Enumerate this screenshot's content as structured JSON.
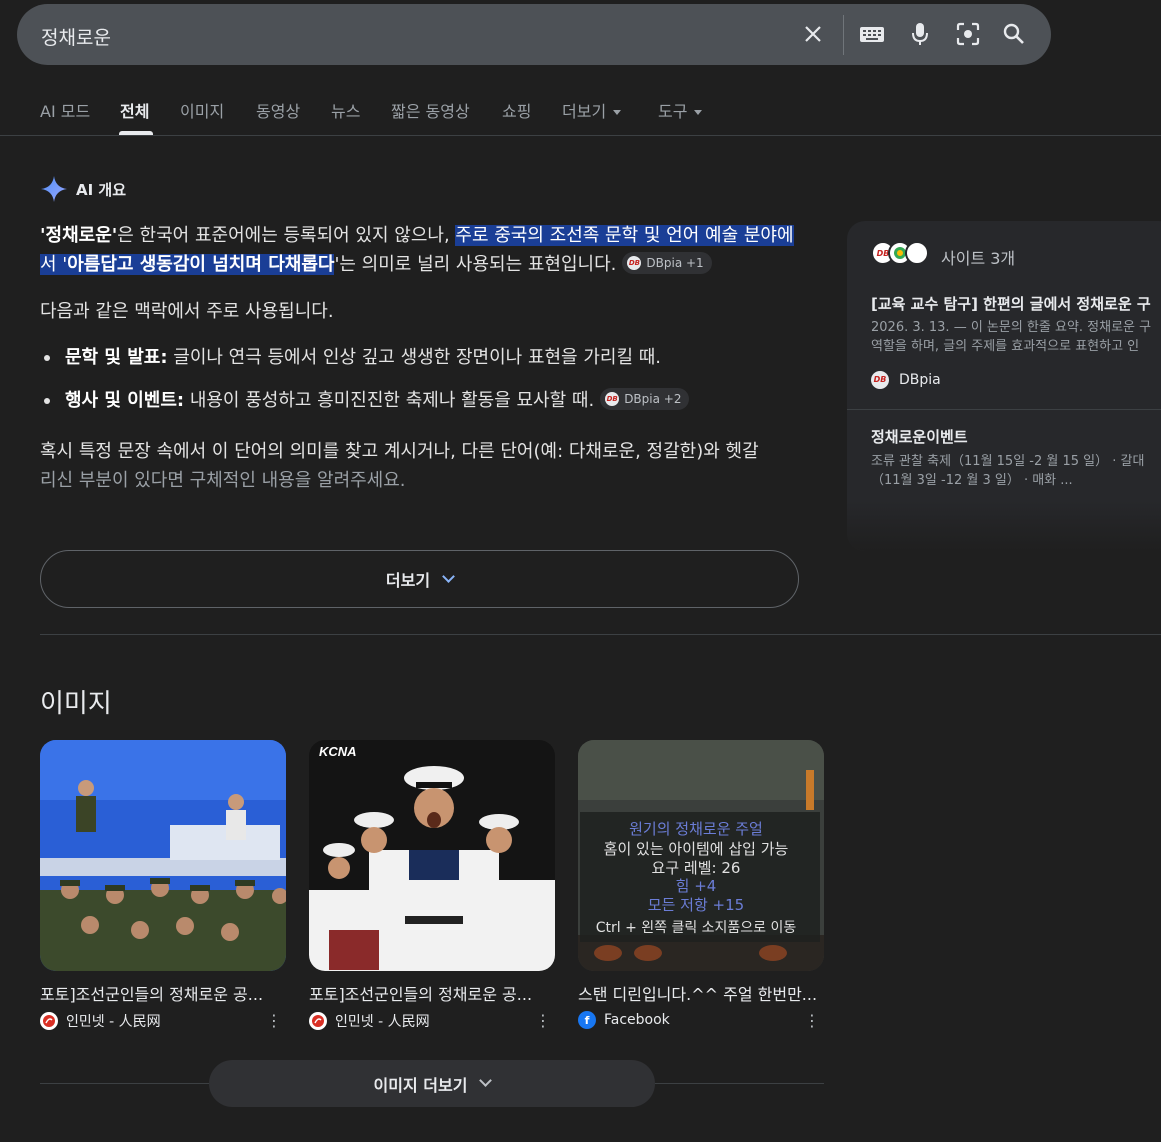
{
  "search": {
    "query": "정채로운"
  },
  "search_icons": [
    "close-icon",
    "keyboard-icon",
    "mic-icon",
    "lens-icon",
    "search-icon"
  ],
  "tabs": [
    {
      "label": "AI 모드"
    },
    {
      "label": "전체",
      "active": true
    },
    {
      "label": "이미지"
    },
    {
      "label": "동영상"
    },
    {
      "label": "뉴스"
    },
    {
      "label": "짧은 동영상"
    },
    {
      "label": "쇼핑"
    },
    {
      "label": "더보기"
    },
    {
      "label": "도구"
    }
  ],
  "ai_overview": {
    "title": "AI 개요",
    "p1": {
      "term": "'정채로운'",
      "t1": "은 한국어 표준어에는 등록되어 있지 않으나, ",
      "hl1": "주로 중국의 조선족 문학 및 언어 예술 분야에서 '",
      "hl2": "아름답고 생동감이 넘치며 다채롭다",
      "t2": "'는 의미로 널리 사용되는 표현입니다.",
      "chip": "DBpia +1"
    },
    "p2": "다음과 같은 맥락에서 주로 사용됩니다.",
    "bullets": [
      {
        "term": "문학 및 발표:",
        "text": " 글이나 연극 등에서 인상 깊고 생생한 장면이나 표현을 가리킬 때.",
        "chip": ""
      },
      {
        "term": "행사 및 이벤트:",
        "text": " 내용이 풍성하고 흥미진진한 축제나 활동을 묘사할 때.",
        "chip": "DBpia +2"
      }
    ],
    "p3a": "혹시 특정 문장 속에서 이 단어의 의미를 찾고 계시거나, 다른 단어(예: 다채로운, 정갈한)와 헷갈",
    "p3b": "리신 부분이 있다면 구체적인 내용을 알려주세요.",
    "more_label": "더보기"
  },
  "sources": {
    "count_label": "사이트 3개",
    "items": [
      {
        "title": "[교육 교수 탐구] 한편의 글에서 정채로운 구",
        "snippet1": "2026. 3. 13. — 이 논문의 한줄 요약. 정채로운 구",
        "snippet2": "역할을 하며, 글의 주제를 효과적으로 표현하고 인",
        "site": "DBpia"
      },
      {
        "title": "정채로운이벤트",
        "snippet1": "조류 관찰 축제（11월 15일 -2 월 15 일） · 갈대",
        "snippet2": "（11월 3일 -12 월 3 일） · 매화 ..."
      }
    ]
  },
  "images": {
    "heading": "이미지",
    "items": [
      {
        "caption": "포토]조선군인들의 정채로운 공...",
        "source": "인민넷 - 人民网"
      },
      {
        "caption": "포토]조선군인들의 정채로운 공...",
        "source": "인민넷 - 人民网",
        "watermark": "KCNA"
      },
      {
        "caption": "스탠 디린입니다.^^ 주얼 한번만...",
        "source": "Facebook",
        "game_text": [
          "원기의 정채로운 주얼",
          "홈이 있는 아이템에 삽입 가능",
          "요구 레벨: 26",
          "힘 +4",
          "모든 저항 +15",
          "Ctrl + 왼쪽 클릭 소지품으로 이동"
        ]
      }
    ],
    "more_label": "이미지 더보기"
  },
  "colors": {
    "background": "#1f1f1f",
    "highlight": "#1a3e96",
    "link_accent": "#8ab4f8"
  }
}
